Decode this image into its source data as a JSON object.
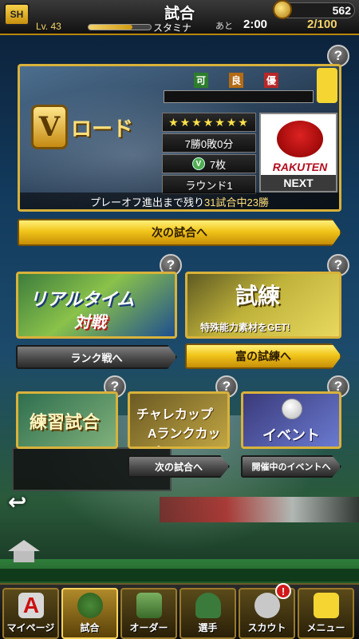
{
  "header": {
    "title": "試合",
    "logo": "SH",
    "currency_value": "562",
    "level": "Lv. 43",
    "stamina_label": "スタミナ",
    "ato_label": "あと",
    "recovery_time": "2:00",
    "stamina_value": "2/100"
  },
  "vroad": {
    "title": "ロード",
    "emblem": "V",
    "flags": [
      "可",
      "良",
      "優"
    ],
    "stars": "★★★★★★★",
    "record": "7勝0敗0分",
    "medals": "7枚",
    "round": "ラウンド1",
    "opponent": "RAKUTEN EAGLES",
    "next_label": "NEXT",
    "progress_prefix": "プレーオフ進出まで残り",
    "progress_highlight": "31試合中23勝"
  },
  "buttons": {
    "next_match": "次の試合へ",
    "rank_battle": "ランク戦へ",
    "trial": "富の試練へ",
    "next_match_small": "次の試合へ",
    "event": "開催中のイベントへ"
  },
  "banners": {
    "realtime_line1": "リアルタイム",
    "realtime_line2": "対戦",
    "trial_title": "試練",
    "trial_sub": "特殊能力素材をGET!",
    "practice": "練習試合",
    "challenge_line1": "チャレ",
    "challenge_cup": "カップ",
    "challenge_line2": "Aランクカップ",
    "event": "イベント"
  },
  "bottom_nav": {
    "items": [
      {
        "label": "マイページ",
        "icon": "A"
      },
      {
        "label": "試合",
        "icon": ""
      },
      {
        "label": "オーダー",
        "icon": ""
      },
      {
        "label": "選手",
        "icon": ""
      },
      {
        "label": "スカウト",
        "icon": ""
      },
      {
        "label": "メニュー",
        "icon": ""
      }
    ],
    "notification": "!"
  },
  "help_label": "?"
}
